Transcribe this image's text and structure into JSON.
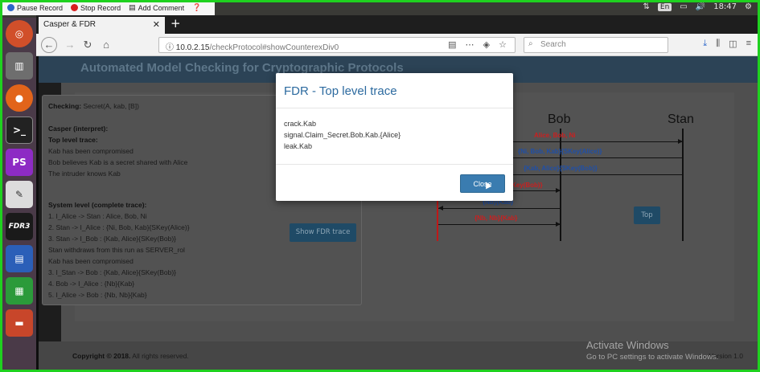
{
  "recording_toolbar": {
    "pause_label": "Pause Record",
    "stop_label": "Stop Record",
    "comment_label": "Add Comment"
  },
  "system_tray": {
    "keyboard_layout": "En",
    "clock": "18:47"
  },
  "browser": {
    "tab_title": "Casper & FDR",
    "new_tab_label": "+",
    "url_host": "10.0.2.15",
    "url_path": "/checkProtocol#showCounterexDiv0",
    "search_placeholder": "Search"
  },
  "launcher": {
    "fdr_label": "FDR3",
    "phpstorm_label": "PS"
  },
  "app": {
    "title": "Automated Model Checking for Cryptographic Protocols",
    "checking_label": "Checking:",
    "checking_value": "Secret(A, kab, [B])",
    "casper_heading": "Casper (interpret):",
    "top_level_heading": "Top level trace:",
    "top_level_lines": [
      "Kab has been compromised",
      "Bob believes Kab is a secret shared with Alice",
      "The intruder knows Kab"
    ],
    "system_level_heading": "System level (complete trace):",
    "system_level_lines": [
      "1. I_Alice -> Stan : Alice, Bob, Ni",
      "2. Stan -> I_Alice : {Ni, Bob, Kab}{SKey(Alice)}",
      "3. Stan -> I_Bob : {Kab, Alice}{SKey(Bob)}",
      "Stan withdraws from this run as SERVER_rol",
      "Kab has been compromised",
      "3. I_Stan -> Bob : {Kab, Alice}{SKey(Bob)}",
      "4. Bob -> I_Alice : {Nb}{Kab}",
      "5. I_Alice -> Bob : {Nb, Nb}{Kab}"
    ],
    "show_fdr_button": "Show FDR trace",
    "top_button": "Top",
    "copyright_label": "Copyright © 2018.",
    "copyright_rest": " All rights reserved.",
    "version": "Version 1.0"
  },
  "sequence": {
    "actors": [
      "Bob",
      "Stan"
    ],
    "messages": [
      "Alice, Bob, Ni",
      "{Ni, Bob, Kab}{SKey(Alice)}",
      "{Kab, Alice}{SKey(Bob)}",
      "Key(Bob)}",
      "{Nb}{Kab}",
      "{Nb, Nb}{Kab}"
    ],
    "colors": {
      "red_message": "#cc1f1f",
      "blue_message": "#1f4fa8"
    }
  },
  "modal": {
    "title": "FDR - Top level trace",
    "lines": [
      "crack.Kab",
      "signal.Claim_Secret.Bob.Kab.{Alice}",
      "leak.Kab"
    ],
    "close_button": "Close"
  },
  "watermark": {
    "line1": "Activate Windows",
    "line2": "Go to PC settings to activate Windows."
  },
  "colors": {
    "frame": "#1fd11f",
    "accent": "#3a7cb0"
  }
}
